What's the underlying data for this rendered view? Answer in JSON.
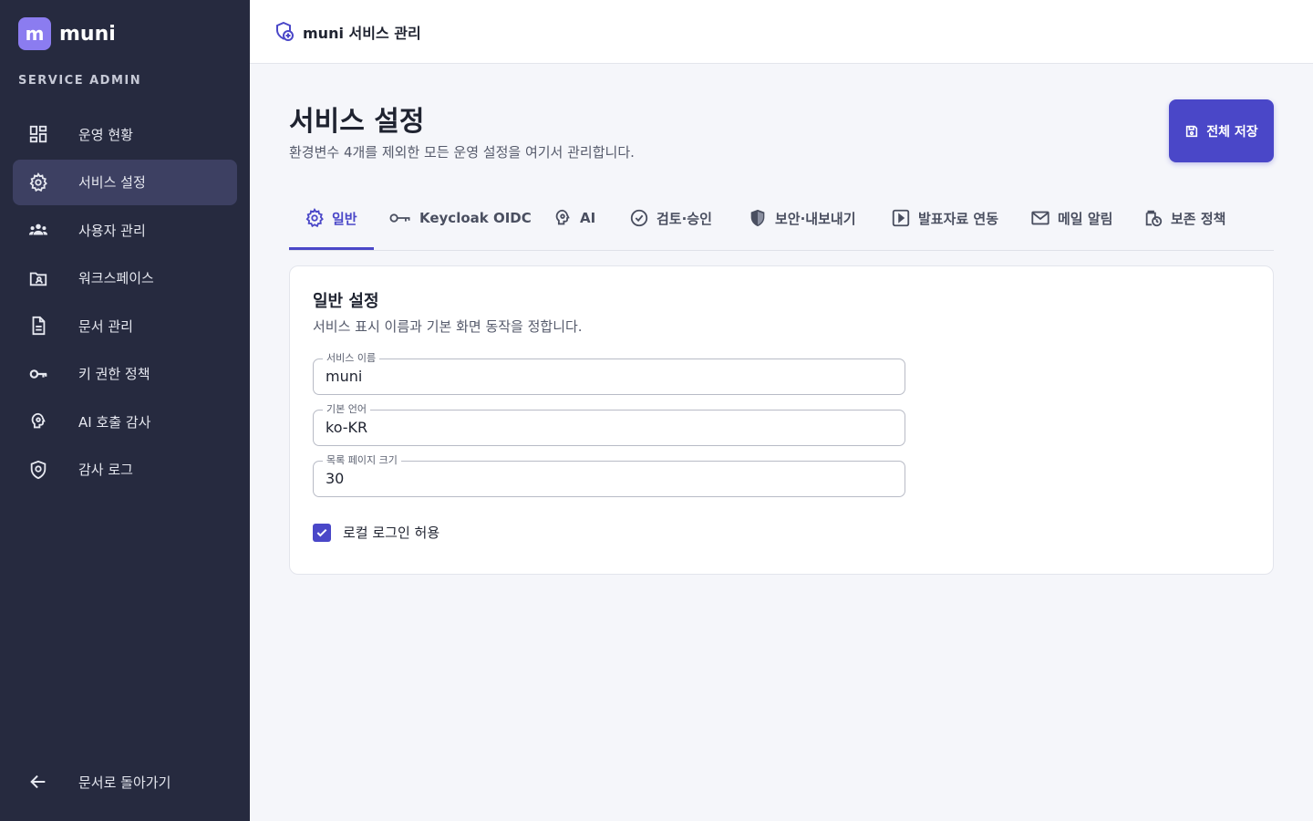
{
  "app": {
    "logo_letter": "m",
    "name": "muni",
    "section": "SERVICE ADMIN"
  },
  "sidebar": {
    "items": [
      {
        "label": "운영 현황",
        "icon": "dashboard-icon"
      },
      {
        "label": "서비스 설정",
        "icon": "gear-icon",
        "active": true
      },
      {
        "label": "사용자 관리",
        "icon": "users-icon"
      },
      {
        "label": "워크스페이스",
        "icon": "workspace-icon"
      },
      {
        "label": "문서 관리",
        "icon": "document-icon"
      },
      {
        "label": "키 권한 정책",
        "icon": "key-icon"
      },
      {
        "label": "AI 호출 감사",
        "icon": "brain-icon"
      },
      {
        "label": "감사 로그",
        "icon": "shield-icon"
      }
    ],
    "back_label": "문서로 돌아가기"
  },
  "topbar": {
    "title": "muni 서비스 관리"
  },
  "page": {
    "title": "서비스 설정",
    "subtitle": "환경변수 4개를 제외한 모든 운영 설정을 여기서 관리합니다.",
    "save_label": "전체 저장"
  },
  "tabs": [
    {
      "label": "일반",
      "icon": "gear-icon",
      "active": true
    },
    {
      "label": "Keycloak OIDC",
      "icon": "key-icon"
    },
    {
      "label": "AI",
      "icon": "brain-icon"
    },
    {
      "label": "검토·승인",
      "icon": "check-circle-icon"
    },
    {
      "label": "보안·내보내기",
      "icon": "shield-icon"
    },
    {
      "label": "발표자료 연동",
      "icon": "slides-icon"
    },
    {
      "label": "메일 알림",
      "icon": "mail-icon"
    },
    {
      "label": "보존 정책",
      "icon": "retention-icon"
    }
  ],
  "card": {
    "title": "일반 설정",
    "description": "서비스 표시 이름과 기본 화면 동작을 정합니다.",
    "fields": [
      {
        "label": "서비스 이름",
        "value": "muni"
      },
      {
        "label": "기본 언어",
        "value": "ko-KR"
      },
      {
        "label": "목록 페이지 크기",
        "value": "30"
      }
    ],
    "checkbox": {
      "label": "로컬 로그인 허용",
      "checked": true
    }
  },
  "colors": {
    "sidebar_bg": "#262a3f",
    "sidebar_active": "#3d4062",
    "accent": "#4a47c8",
    "logo": "#8b7cf0",
    "page_bg": "#f5f6fa"
  }
}
